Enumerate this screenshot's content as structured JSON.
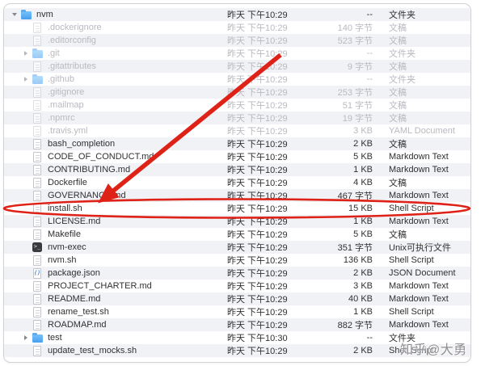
{
  "window": {
    "kind": "finder-list-view"
  },
  "files": [
    {
      "name": "nvm",
      "level": 0,
      "icon": "folder",
      "disclosure": "down",
      "date": "昨天 下午10:29",
      "size": "--",
      "kind": "文件夹",
      "dim": false
    },
    {
      "name": ".dockerignore",
      "level": 1,
      "icon": "doc",
      "disclosure": "none",
      "date": "昨天 下午10:29",
      "size": "140 字节",
      "kind": "文稿",
      "dim": true
    },
    {
      "name": ".editorconfig",
      "level": 1,
      "icon": "doc",
      "disclosure": "none",
      "date": "昨天 下午10:29",
      "size": "523 字节",
      "kind": "文稿",
      "dim": true
    },
    {
      "name": ".git",
      "level": 1,
      "icon": "folder",
      "disclosure": "right",
      "date": "昨天 下午10:29",
      "size": "--",
      "kind": "文件夹",
      "dim": true
    },
    {
      "name": ".gitattributes",
      "level": 1,
      "icon": "doc",
      "disclosure": "none",
      "date": "昨天 下午10:29",
      "size": "9 字节",
      "kind": "文稿",
      "dim": true
    },
    {
      "name": ".github",
      "level": 1,
      "icon": "folder",
      "disclosure": "right",
      "date": "昨天 下午10:29",
      "size": "--",
      "kind": "文件夹",
      "dim": true
    },
    {
      "name": ".gitignore",
      "level": 1,
      "icon": "doc",
      "disclosure": "none",
      "date": "昨天 下午10:29",
      "size": "253 字节",
      "kind": "文稿",
      "dim": true
    },
    {
      "name": ".mailmap",
      "level": 1,
      "icon": "doc",
      "disclosure": "none",
      "date": "昨天 下午10:29",
      "size": "51 字节",
      "kind": "文稿",
      "dim": true
    },
    {
      "name": ".npmrc",
      "level": 1,
      "icon": "doc",
      "disclosure": "none",
      "date": "昨天 下午10:29",
      "size": "19 字节",
      "kind": "文稿",
      "dim": true
    },
    {
      "name": ".travis.yml",
      "level": 1,
      "icon": "doc",
      "disclosure": "none",
      "date": "昨天 下午10:29",
      "size": "3 KB",
      "kind": "YAML Document",
      "dim": true
    },
    {
      "name": "bash_completion",
      "level": 1,
      "icon": "doc",
      "disclosure": "none",
      "date": "昨天 下午10:29",
      "size": "2 KB",
      "kind": "文稿",
      "dim": false
    },
    {
      "name": "CODE_OF_CONDUCT.md",
      "level": 1,
      "icon": "doc",
      "disclosure": "none",
      "date": "昨天 下午10:29",
      "size": "5 KB",
      "kind": "Markdown Text",
      "dim": false
    },
    {
      "name": "CONTRIBUTING.md",
      "level": 1,
      "icon": "doc",
      "disclosure": "none",
      "date": "昨天 下午10:29",
      "size": "1 KB",
      "kind": "Markdown Text",
      "dim": false
    },
    {
      "name": "Dockerfile",
      "level": 1,
      "icon": "doc",
      "disclosure": "none",
      "date": "昨天 下午10:29",
      "size": "4 KB",
      "kind": "文稿",
      "dim": false
    },
    {
      "name": "GOVERNANCE.md",
      "level": 1,
      "icon": "doc",
      "disclosure": "none",
      "date": "昨天 下午10:29",
      "size": "467 字节",
      "kind": "Markdown Text",
      "dim": false
    },
    {
      "name": "install.sh",
      "level": 1,
      "icon": "doc",
      "disclosure": "none",
      "date": "昨天 下午10:29",
      "size": "15 KB",
      "kind": "Shell Script",
      "dim": false
    },
    {
      "name": "LICENSE.md",
      "level": 1,
      "icon": "doc",
      "disclosure": "none",
      "date": "昨天 下午10:29",
      "size": "1 KB",
      "kind": "Markdown Text",
      "dim": false
    },
    {
      "name": "Makefile",
      "level": 1,
      "icon": "doc",
      "disclosure": "none",
      "date": "昨天 下午10:29",
      "size": "5 KB",
      "kind": "文稿",
      "dim": false
    },
    {
      "name": "nvm-exec",
      "level": 1,
      "icon": "exec",
      "disclosure": "none",
      "date": "昨天 下午10:29",
      "size": "351 字节",
      "kind": "Unix可执行文件",
      "dim": false
    },
    {
      "name": "nvm.sh",
      "level": 1,
      "icon": "doc",
      "disclosure": "none",
      "date": "昨天 下午10:29",
      "size": "136 KB",
      "kind": "Shell Script",
      "dim": false
    },
    {
      "name": "package.json",
      "level": 1,
      "icon": "json",
      "disclosure": "none",
      "date": "昨天 下午10:29",
      "size": "2 KB",
      "kind": "JSON Document",
      "dim": false
    },
    {
      "name": "PROJECT_CHARTER.md",
      "level": 1,
      "icon": "doc",
      "disclosure": "none",
      "date": "昨天 下午10:29",
      "size": "3 KB",
      "kind": "Markdown Text",
      "dim": false
    },
    {
      "name": "README.md",
      "level": 1,
      "icon": "doc",
      "disclosure": "none",
      "date": "昨天 下午10:29",
      "size": "40 KB",
      "kind": "Markdown Text",
      "dim": false
    },
    {
      "name": "rename_test.sh",
      "level": 1,
      "icon": "doc",
      "disclosure": "none",
      "date": "昨天 下午10:29",
      "size": "1 KB",
      "kind": "Shell Script",
      "dim": false
    },
    {
      "name": "ROADMAP.md",
      "level": 1,
      "icon": "doc",
      "disclosure": "none",
      "date": "昨天 下午10:29",
      "size": "882 字节",
      "kind": "Markdown Text",
      "dim": false
    },
    {
      "name": "test",
      "level": 1,
      "icon": "folder",
      "disclosure": "right",
      "date": "昨天 下午10:30",
      "size": "--",
      "kind": "文件夹",
      "dim": false
    },
    {
      "name": "update_test_mocks.sh",
      "level": 1,
      "icon": "doc",
      "disclosure": "none",
      "date": "昨天 下午10:29",
      "size": "2 KB",
      "kind": "Shell Script",
      "dim": false
    }
  ],
  "annotation": {
    "color": "#df2217"
  },
  "watermark": "知乎@大勇"
}
